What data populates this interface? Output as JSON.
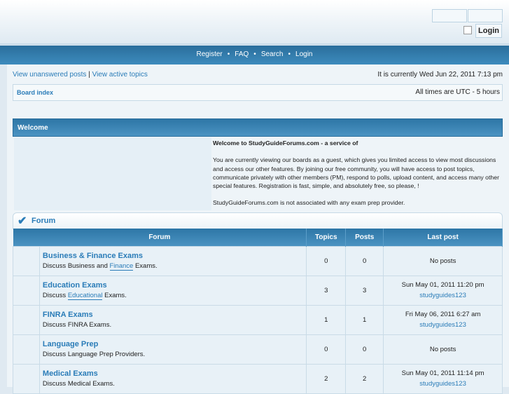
{
  "header": {
    "login_button": "Login"
  },
  "nav": {
    "items": [
      "Register",
      "FAQ",
      "Search",
      "Login"
    ]
  },
  "links": {
    "unanswered": "View unanswered posts",
    "separator": "|",
    "active": "View active topics",
    "current_time": "It is currently Wed Jun 22, 2011 7:13 pm"
  },
  "breadcrumb": {
    "board_index": "Board index",
    "timezone": "All times are UTC - 5 hours"
  },
  "welcome": {
    "title": "Welcome",
    "heading": "Welcome to StudyGuideForums.com - a service of",
    "body": "You are currently viewing our boards as a guest, which gives you limited access to view most discussions and access our other features. By joining our free community, you will have access to post topics, communicate privately with other members (PM), respond to polls, upload content, and access many other special features. Registration is fast, simple, and absolutely free, so please, !",
    "disclaimer": "StudyGuideForums.com is not associated with any exam prep provider."
  },
  "forum": {
    "title": "Forum",
    "columns": [
      "Forum",
      "Topics",
      "Posts",
      "Last post"
    ],
    "rows": [
      {
        "name": "Business & Finance Exams",
        "desc_pre": "Discuss Business and ",
        "desc_kw": "Finance",
        "desc_post": " Exams.",
        "topics": "0",
        "posts": "0",
        "last": "No posts",
        "user": ""
      },
      {
        "name": "Education Exams",
        "desc_pre": "Discuss ",
        "desc_kw": "Educational",
        "desc_post": " Exams.",
        "topics": "3",
        "posts": "3",
        "last": "Sun May 01, 2011 11:20 pm",
        "user": "studyguides123"
      },
      {
        "name": "FINRA Exams",
        "desc_pre": "Discuss FINRA Exams.",
        "desc_kw": "",
        "desc_post": "",
        "topics": "1",
        "posts": "1",
        "last": "Fri May 06, 2011 6:27 am",
        "user": "studyguides123"
      },
      {
        "name": "Language Prep",
        "desc_pre": "Discuss Language Prep Providers.",
        "desc_kw": "",
        "desc_post": "",
        "topics": "0",
        "posts": "0",
        "last": "No posts",
        "user": ""
      },
      {
        "name": "Medical Exams",
        "desc_pre": "Discuss Medical Exams.",
        "desc_kw": "",
        "desc_post": "",
        "topics": "2",
        "posts": "2",
        "last": "Sun May 01, 2011 11:14 pm",
        "user": "studyguides123"
      }
    ]
  }
}
